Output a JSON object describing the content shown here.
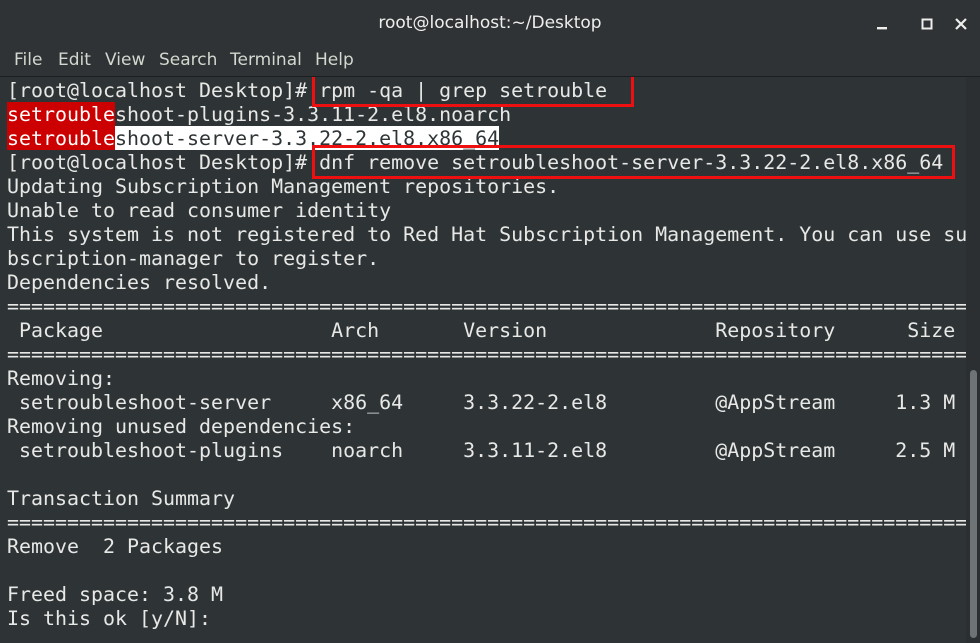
{
  "window": {
    "title": "root@localhost:~/Desktop"
  },
  "menu": [
    "File",
    "Edit",
    "View",
    "Search",
    "Terminal",
    "Help"
  ],
  "terminal": {
    "line1": {
      "prompt": "[root@localhost Desktop]# ",
      "command": "rpm -qa | grep setrouble"
    },
    "line2": {
      "match": "setrouble",
      "rest": "shoot-plugins-3.3.11-2.el8.noarch"
    },
    "line3": {
      "match": "setrouble",
      "rest": "shoot-server-3.3.22-2.el8.x86_64"
    },
    "line4": {
      "prompt": "[root@localhost Desktop]# ",
      "command": "dnf remove setroubleshoot-server-3.3.22-2.el8.x86_64"
    },
    "line5": "Updating Subscription Management repositories.",
    "line6": "Unable to read consumer identity",
    "line7": "This system is not registered to Red Hat Subscription Management. You can use su",
    "line8": "bscription-manager to register.",
    "line9": "Dependencies resolved.",
    "line10": "================================================================================",
    "line11": " Package                   Arch       Version              Repository      Size",
    "line12": "================================================================================",
    "line13": "Removing:",
    "line14": " setroubleshoot-server     x86_64     3.3.22-2.el8         @AppStream     1.3 M",
    "line15": "Removing unused dependencies:",
    "line16": " setroubleshoot-plugins    noarch     3.3.11-2.el8         @AppStream     2.5 M",
    "line17": "",
    "line18": "Transaction Summary",
    "line19": "================================================================================",
    "line20": "Remove  2 Packages",
    "line21": "",
    "line22": "Freed space: 3.8 M",
    "line23": "Is this ok [y/N]: "
  },
  "colors": {
    "terminal_bg": "#2e3436",
    "annotation": "#ee1010",
    "grep_match": "#cc0000"
  }
}
